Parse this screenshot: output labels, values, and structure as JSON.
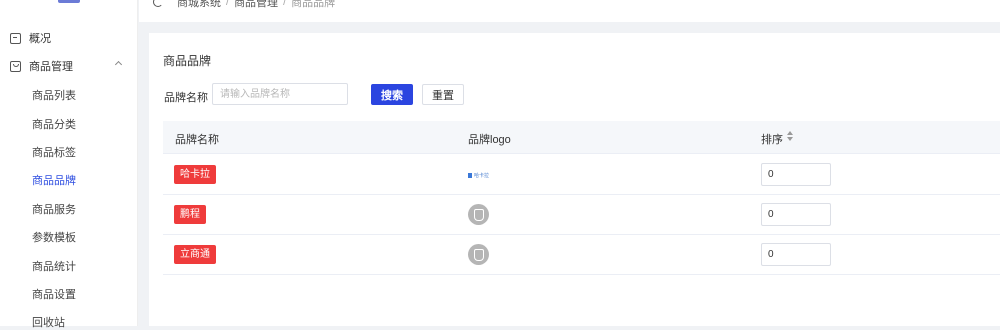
{
  "sidebar": {
    "overview_label": "概况",
    "goods_label": "商品管理",
    "goods_items": [
      {
        "label": "商品列表",
        "active": false
      },
      {
        "label": "商品分类",
        "active": false
      },
      {
        "label": "商品标签",
        "active": false
      },
      {
        "label": "商品品牌",
        "active": true
      },
      {
        "label": "商品服务",
        "active": false
      },
      {
        "label": "参数模板",
        "active": false
      },
      {
        "label": "商品统计",
        "active": false
      },
      {
        "label": "商品设置",
        "active": false
      },
      {
        "label": "回收站",
        "active": false
      }
    ],
    "accent_color": "#2d4de0"
  },
  "breadcrumb": {
    "items": [
      "商城系统",
      "商品管理"
    ],
    "current": "商品品牌"
  },
  "page": {
    "title": "商品品牌"
  },
  "filter": {
    "label": "品牌名称",
    "placeholder": "请输入品牌名称",
    "value": "",
    "search_label": "搜索",
    "reset_label": "重置",
    "search_color": "#2b45e0"
  },
  "table": {
    "columns": [
      "品牌名称",
      "品牌logo",
      "排序"
    ],
    "rows": [
      {
        "name": "哈卡拉",
        "logo": "brand-logo-mini",
        "logo_text": "哈卡拉",
        "sort": "0"
      },
      {
        "name": "鹏程",
        "logo": "placeholder-shield-icon",
        "sort": "0"
      },
      {
        "name": "立商通",
        "logo": "placeholder-shield-icon",
        "sort": "0"
      }
    ],
    "tag_color": "#ef3b3b"
  }
}
